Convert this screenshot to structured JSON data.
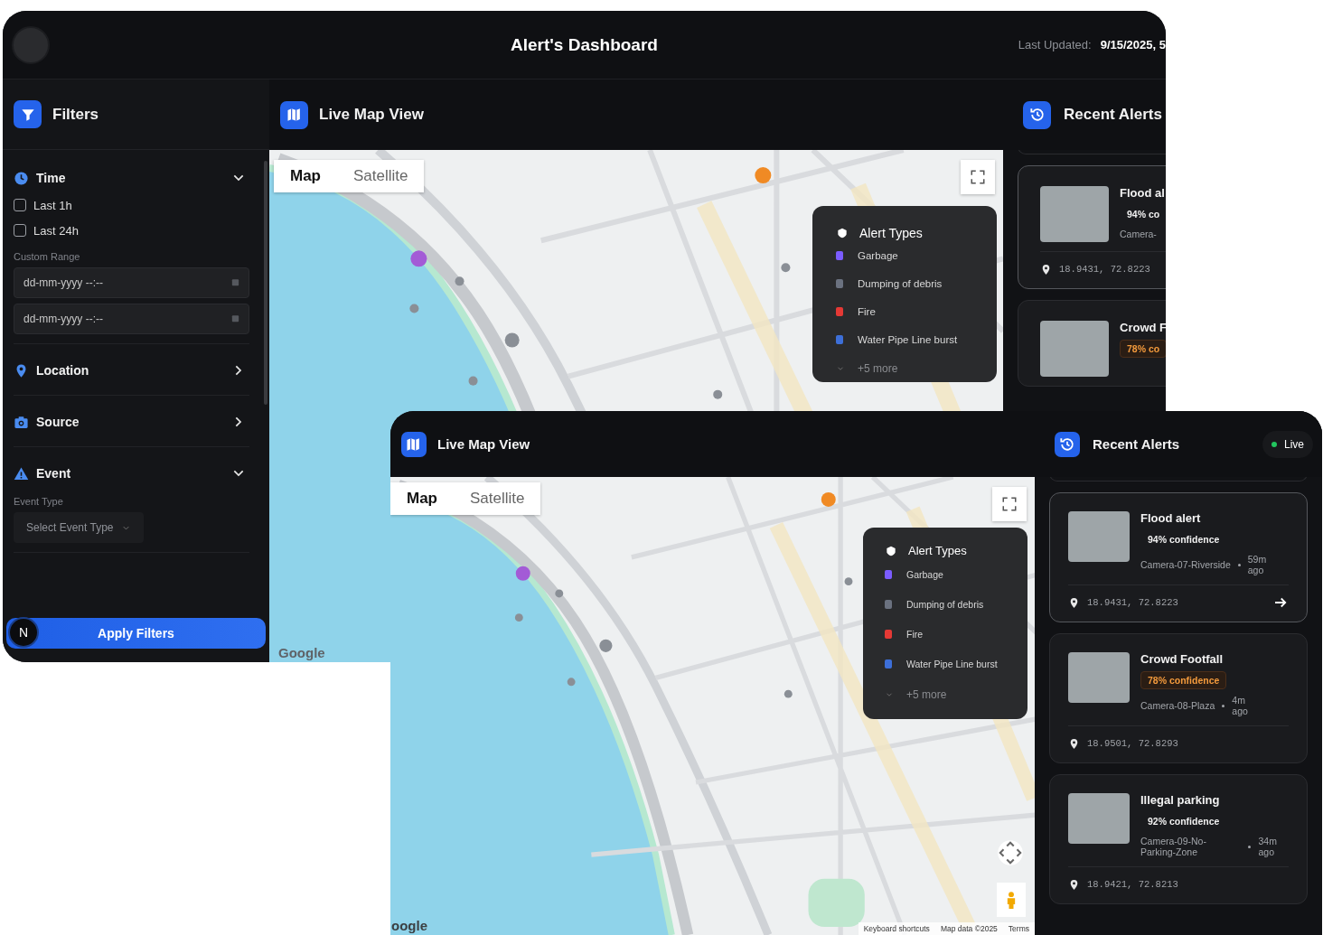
{
  "back_window": {
    "title": "Alert's Dashboard",
    "last_updated": {
      "label": "Last Updated:",
      "value": "9/15/2025, 5"
    },
    "filters": {
      "title": "Filters",
      "sections": [
        {
          "kind": "time",
          "label": "Time",
          "expanded": true,
          "options": [
            {
              "label": "Last 1h",
              "checked": false
            },
            {
              "label": "Last 24h",
              "checked": false
            }
          ],
          "range_label": "Custom Range",
          "date_fields": [
            {
              "placeholder": "dd-mm-yyyy --:--"
            },
            {
              "placeholder": "dd-mm-yyyy --:--"
            }
          ]
        },
        {
          "kind": "location",
          "label": "Location",
          "expanded": false
        },
        {
          "kind": "source",
          "label": "Source",
          "expanded": false
        },
        {
          "kind": "event",
          "label": "Event",
          "expanded": true,
          "field_label": "Event Type",
          "select": {
            "placeholder": "Select Event Type"
          }
        }
      ],
      "apply_button": "Apply Filters",
      "dev_badge": "N"
    },
    "map_panel": {
      "title": "Live Map View",
      "map_types": [
        {
          "label": "Map",
          "selected": true
        },
        {
          "label": "Satellite",
          "selected": false
        }
      ],
      "legend": {
        "title": "Alert Types",
        "items": [
          {
            "label": "Garbage",
            "color": "#7b5cff"
          },
          {
            "label": "Dumping of debris",
            "color": "#6b7280"
          },
          {
            "label": "Fire",
            "color": "#e53935"
          },
          {
            "label": "Water Pipe Line burst",
            "color": "#3d6fd8"
          }
        ],
        "more": "+5 more"
      },
      "attribution": "Google"
    },
    "alerts_panel": {
      "title": "Recent Alerts",
      "alerts": [
        {
          "title": "Flood al",
          "confidence": "94% co",
          "color": "#f0f0f0",
          "camera": "Camera-",
          "coords": "18.9431, 72.8223",
          "hovered": true
        },
        {
          "title": "Crowd F",
          "confidence": "78% co",
          "color": "#f39a3c",
          "hovered": false
        }
      ]
    }
  },
  "front_window": {
    "map_panel": {
      "title": "Live Map View",
      "map_types": [
        {
          "label": "Map",
          "selected": true
        },
        {
          "label": "Satellite",
          "selected": false
        }
      ],
      "legend": {
        "title": "Alert Types",
        "items": [
          {
            "label": "Garbage",
            "color": "#7b5cff"
          },
          {
            "label": "Dumping of debris",
            "color": "#6b7280"
          },
          {
            "label": "Fire",
            "color": "#e53935"
          },
          {
            "label": "Water Pipe Line burst",
            "color": "#3d6fd8"
          }
        ],
        "more": "+5 more"
      },
      "attribution": "oogle",
      "footer_links": [
        "Keyboard shortcuts",
        "Map data ©2025",
        "Terms"
      ]
    },
    "alerts_panel": {
      "title": "Recent Alerts",
      "live": "Live",
      "alerts": [
        {
          "title": "Flood alert",
          "confidence": "94% confidence",
          "color": "#f0f0f0",
          "camera": "Camera-07-Riverside",
          "time": "59m ago",
          "coords": "18.9431, 72.8223",
          "hovered": true
        },
        {
          "title": "Crowd Footfall",
          "confidence": "78% confidence",
          "color": "#f39a3c",
          "camera": "Camera-08-Plaza",
          "time": "4m ago",
          "coords": "18.9501, 72.8293",
          "hovered": false
        },
        {
          "title": "Illegal parking",
          "confidence": "92% confidence",
          "color": "#f0f0f0",
          "camera": "Camera-09-No-Parking-Zone",
          "time": "34m ago",
          "coords": "18.9421, 72.8213",
          "hovered": false
        }
      ]
    }
  }
}
